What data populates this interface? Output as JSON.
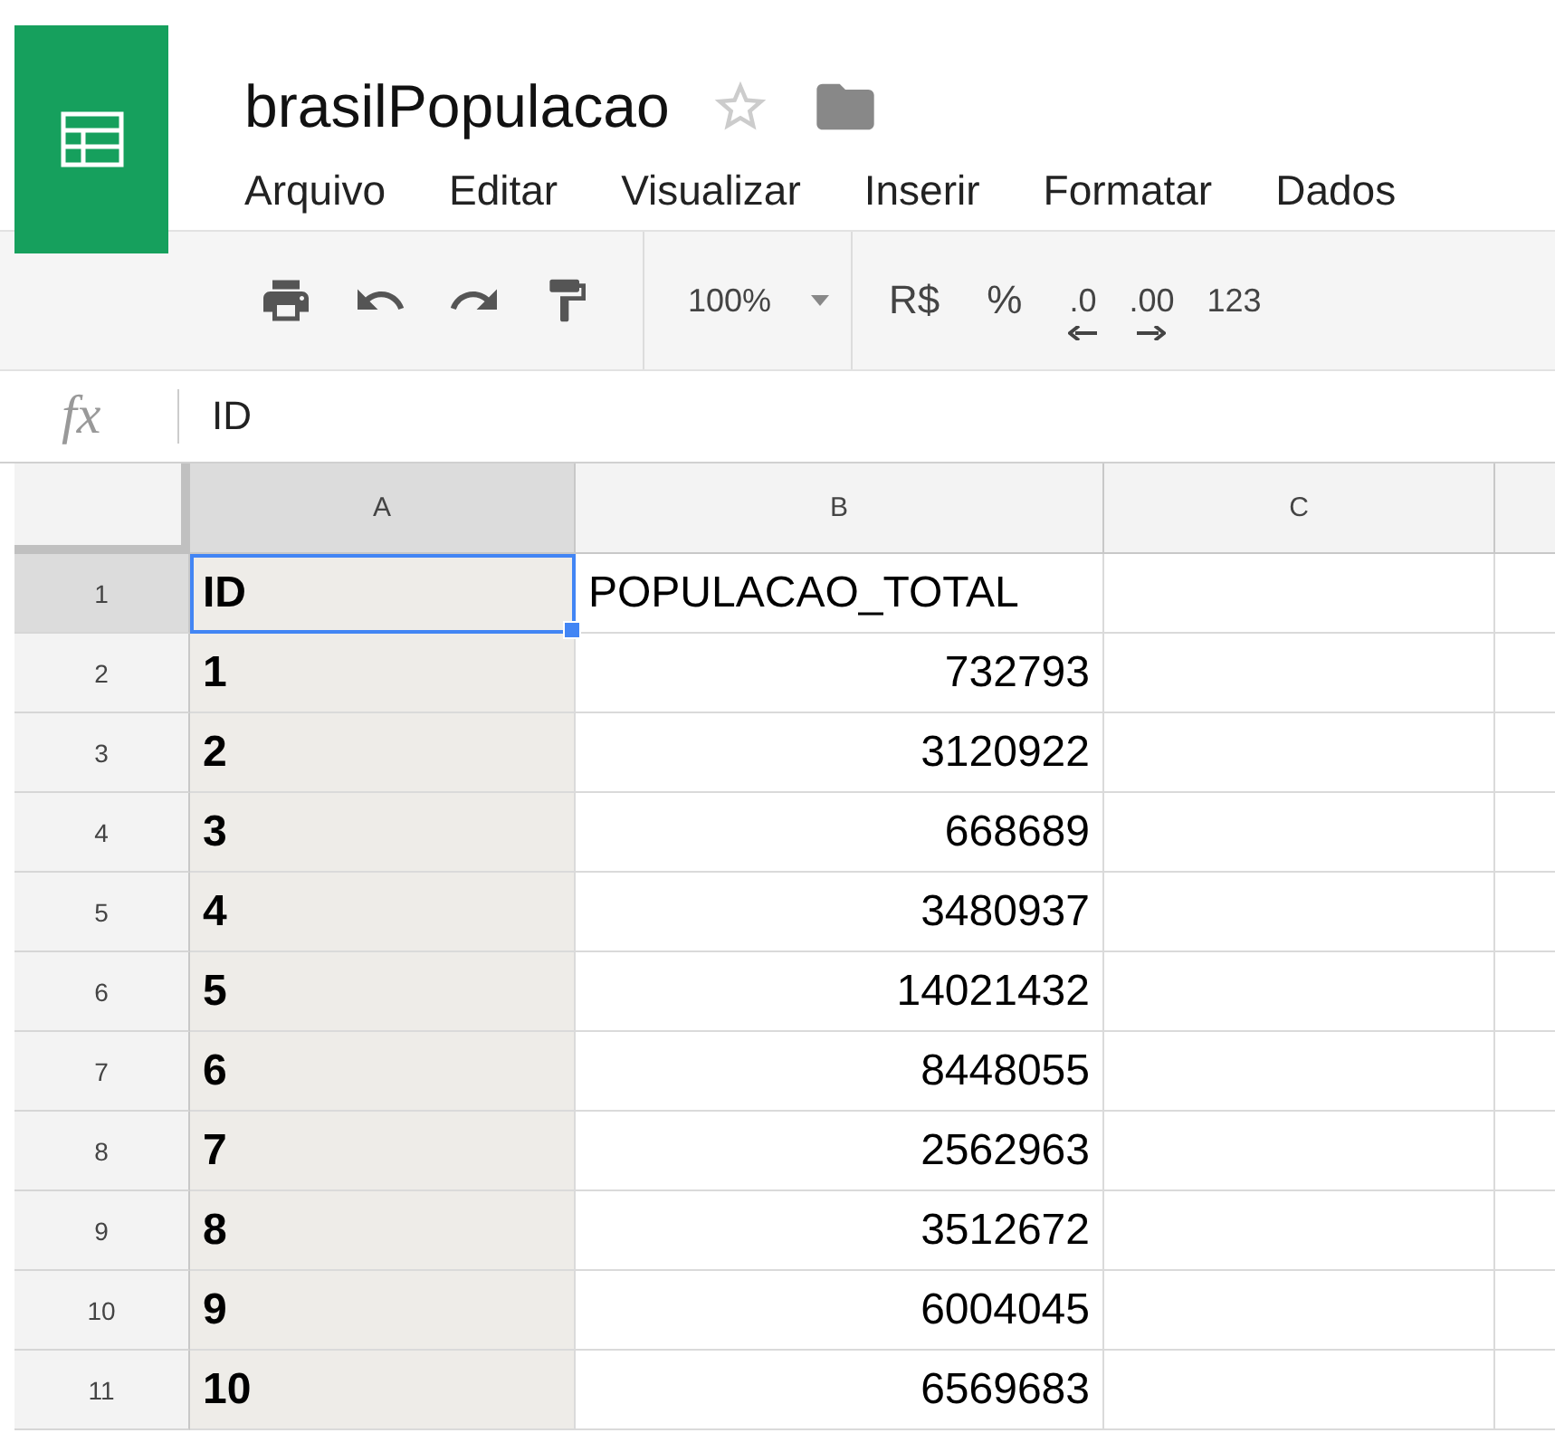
{
  "document": {
    "title": "brasilPopulacao",
    "starred": false
  },
  "menu": [
    "Arquivo",
    "Editar",
    "Visualizar",
    "Inserir",
    "Formatar",
    "Dados"
  ],
  "toolbar": {
    "zoom": "100%",
    "format_buttons": [
      {
        "label": "R$",
        "kind": "plain"
      },
      {
        "label": "%",
        "kind": "plain"
      },
      {
        "label": ".0",
        "kind": "decrease"
      },
      {
        "label": ".00",
        "kind": "increase"
      },
      {
        "label": "123",
        "kind": "dropdown"
      }
    ]
  },
  "formula_bar": {
    "label": "fx",
    "value": "ID"
  },
  "columns": [
    {
      "label": "A",
      "selected": true
    },
    {
      "label": "B",
      "selected": false
    },
    {
      "label": "C",
      "selected": false
    }
  ],
  "rows": [
    {
      "number": "1",
      "selected": true,
      "cells": [
        {
          "value": "ID",
          "active": true
        },
        {
          "value": "POPULACAO_TOTAL",
          "active": false
        }
      ]
    },
    {
      "number": "2",
      "selected": false,
      "cells": [
        {
          "value": "1",
          "active": false
        },
        {
          "value": "732793",
          "active": false
        }
      ]
    },
    {
      "number": "3",
      "selected": false,
      "cells": [
        {
          "value": "2",
          "active": false
        },
        {
          "value": "3120922",
          "active": false
        }
      ]
    },
    {
      "number": "4",
      "selected": false,
      "cells": [
        {
          "value": "3",
          "active": false
        },
        {
          "value": "668689",
          "active": false
        }
      ]
    },
    {
      "number": "5",
      "selected": false,
      "cells": [
        {
          "value": "4",
          "active": false
        },
        {
          "value": "3480937",
          "active": false
        }
      ]
    },
    {
      "number": "6",
      "selected": false,
      "cells": [
        {
          "value": "5",
          "active": false
        },
        {
          "value": "14021432",
          "active": false
        }
      ]
    },
    {
      "number": "7",
      "selected": false,
      "cells": [
        {
          "value": "6",
          "active": false
        },
        {
          "value": "8448055",
          "active": false
        }
      ]
    },
    {
      "number": "8",
      "selected": false,
      "cells": [
        {
          "value": "7",
          "active": false
        },
        {
          "value": "2562963",
          "active": false
        }
      ]
    },
    {
      "number": "9",
      "selected": false,
      "cells": [
        {
          "value": "8",
          "active": false
        },
        {
          "value": "3512672",
          "active": false
        }
      ]
    },
    {
      "number": "10",
      "selected": false,
      "cells": [
        {
          "value": "9",
          "active": false
        },
        {
          "value": "6004045",
          "active": false
        }
      ]
    },
    {
      "number": "11",
      "selected": false,
      "cells": [
        {
          "value": "10",
          "active": false
        },
        {
          "value": "6569683",
          "active": false
        }
      ]
    }
  ]
}
